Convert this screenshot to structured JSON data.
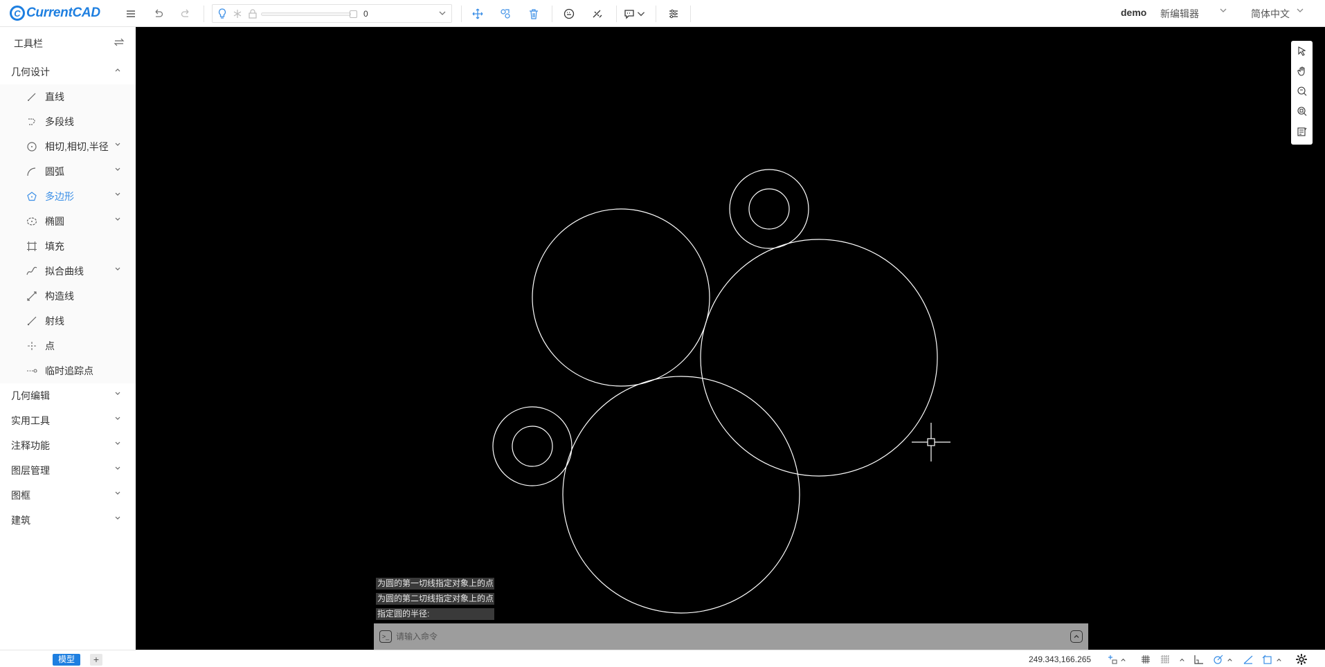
{
  "app": {
    "logo_mark": "C",
    "logo_text": "CurrentCAD"
  },
  "toolbar": {
    "layer_value": "0",
    "user": "demo",
    "editor": "新编辑器",
    "language": "简体中文"
  },
  "sidebar": {
    "title": "工具栏",
    "groups": [
      {
        "label": "几何设计",
        "expanded": true
      },
      {
        "label": "几何编辑"
      },
      {
        "label": "实用工具"
      },
      {
        "label": "注释功能"
      },
      {
        "label": "图层管理"
      },
      {
        "label": "图框"
      },
      {
        "label": "建筑"
      }
    ],
    "design_items": [
      {
        "label": "直线",
        "icon": "line-icon"
      },
      {
        "label": "多段线",
        "icon": "polyline-icon"
      },
      {
        "label": "相切,相切,半径",
        "icon": "circle-tangent-icon",
        "submenu": true
      },
      {
        "label": "圆弧",
        "icon": "arc-icon",
        "submenu": true
      },
      {
        "label": "多边形",
        "icon": "polygon-icon",
        "submenu": true,
        "active": true
      },
      {
        "label": "椭圆",
        "icon": "ellipse-icon",
        "submenu": true
      },
      {
        "label": "填充",
        "icon": "hatch-icon"
      },
      {
        "label": "拟合曲线",
        "icon": "spline-icon",
        "submenu": true
      },
      {
        "label": "构造线",
        "icon": "construction-line-icon"
      },
      {
        "label": "射线",
        "icon": "ray-icon"
      },
      {
        "label": "点",
        "icon": "point-icon"
      },
      {
        "label": "临时追踪点",
        "icon": "tracking-point-icon"
      }
    ]
  },
  "command": {
    "history": [
      "为圆的第一切线指定对象上的点",
      "为圆的第二切线指定对象上的点",
      "指定圆的半径:"
    ],
    "placeholder": "请输入命令"
  },
  "status": {
    "tab_model": "模型",
    "tab_add": "+",
    "coordinates": "249.343,166.265"
  },
  "colors": {
    "accent": "#1e7fe0",
    "active": "#3a8ee6",
    "canvas": "#000000",
    "stroke": "#ffffff"
  }
}
